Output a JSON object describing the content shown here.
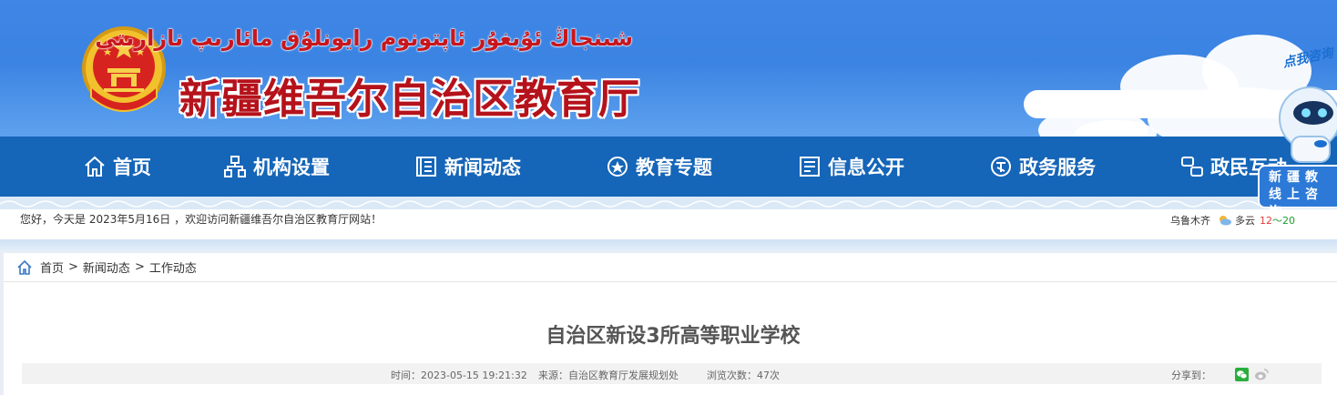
{
  "header": {
    "title_ug": "شىنجاڭ ئۇيغۇر ئاپتونوم رايونلۇق مائارىپ نازارىتى",
    "title_cn": "新疆维吾尔自治区教育厅",
    "search_placeholder": "",
    "consult_tag": "点我咨询"
  },
  "nav": {
    "items": [
      {
        "label": "首页",
        "icon": "home-icon"
      },
      {
        "label": "机构设置",
        "icon": "org-chart-icon"
      },
      {
        "label": "新闻动态",
        "icon": "news-icon"
      },
      {
        "label": "教育专题",
        "icon": "topic-icon"
      },
      {
        "label": "信息公开",
        "icon": "info-icon"
      },
      {
        "label": "政务服务",
        "icon": "gov-icon"
      },
      {
        "label": "政民互动",
        "icon": "interaction-icon"
      }
    ]
  },
  "online_consult": {
    "line1": "新疆教",
    "line2": "线上咨询"
  },
  "welcome": {
    "text": "您好，今天是 2023年5月16日 ，欢迎访问新疆维吾尔自治区教育厅网站！",
    "city": "乌鲁木齐",
    "weather": "多云",
    "temp_low": "12",
    "temp_sep": "～",
    "temp_high": "20"
  },
  "breadcrumb": {
    "items": [
      "首页",
      "新闻动态",
      "工作动态"
    ],
    "separator": ">"
  },
  "article": {
    "title": "自治区新设3所高等职业学校",
    "time_label": "时间：2023-05-15 19:21:32",
    "source_label": "来源：自治区教育厅发展规划处",
    "views_label": "浏览次数：47次",
    "share_label": "分享到："
  },
  "colors": {
    "header_blue": "#3f86e6",
    "nav_blue": "#1565b8",
    "title_red": "#b5121b",
    "wechat_green": "#2aae3d"
  }
}
